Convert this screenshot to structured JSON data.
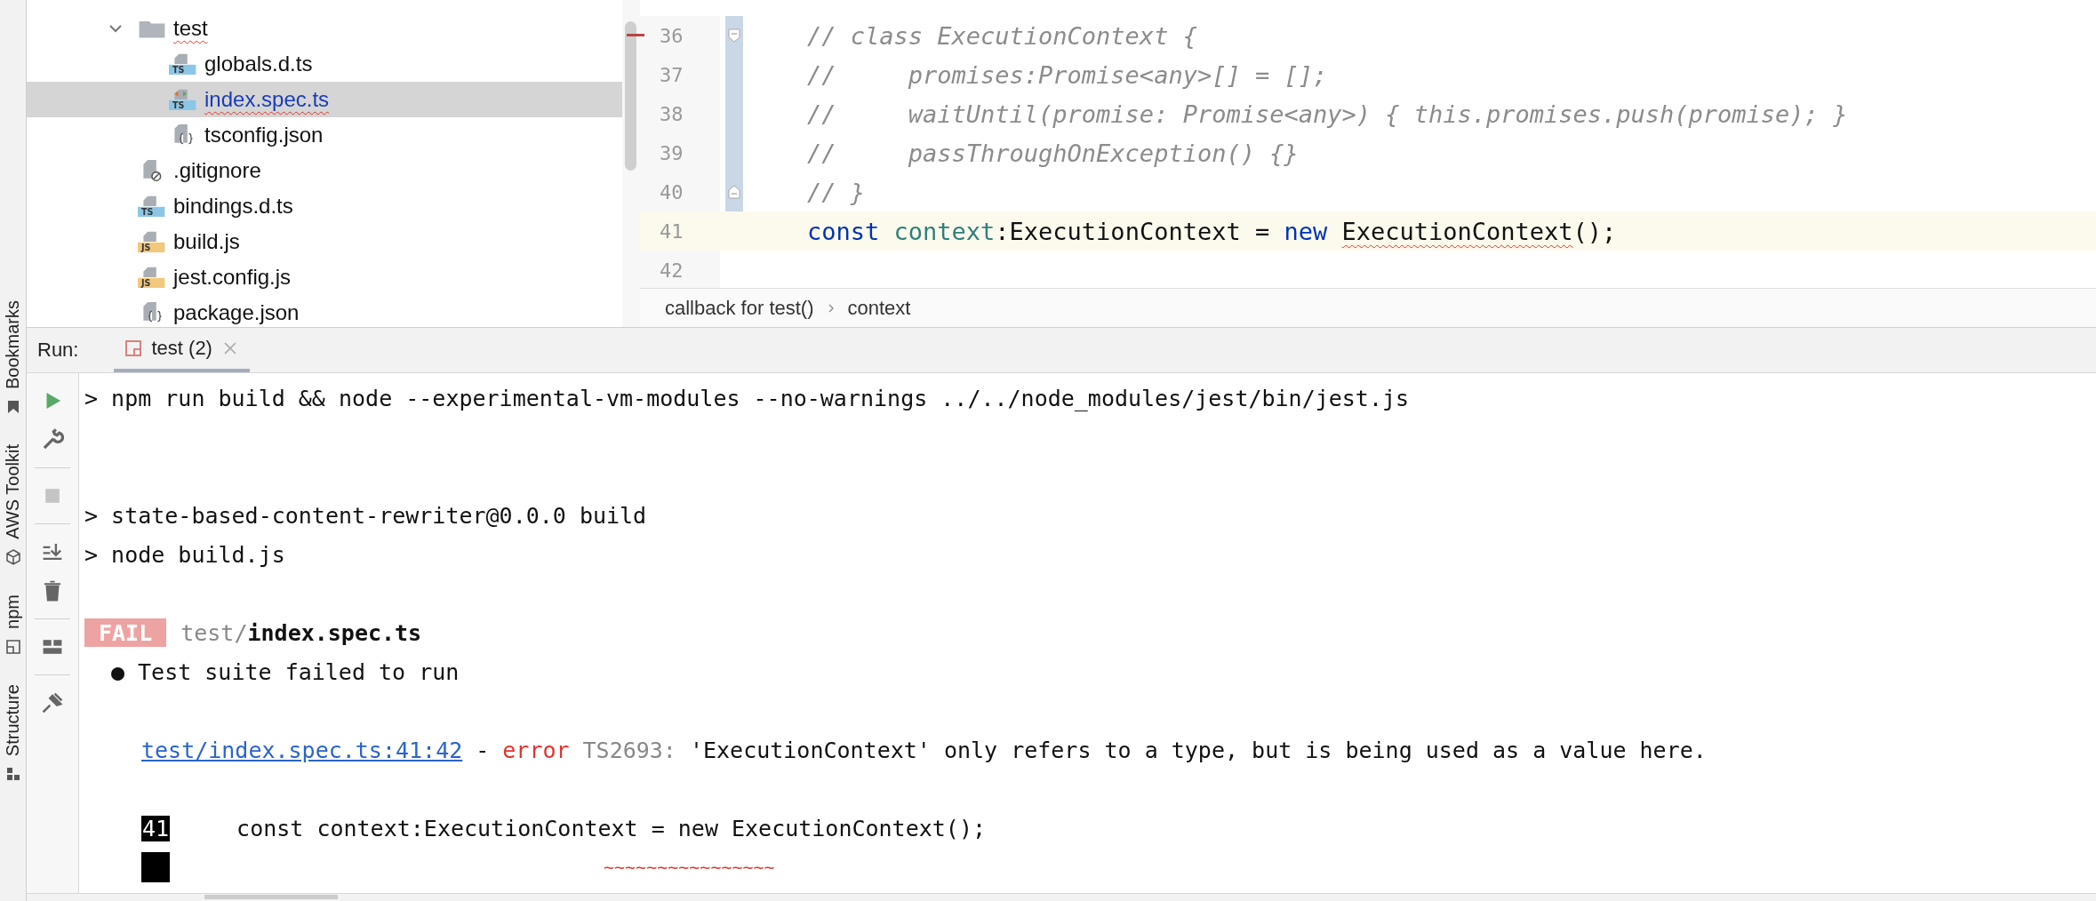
{
  "side_strip": {
    "items": [
      {
        "label": "Bookmarks",
        "kind": "bookmark"
      },
      {
        "label": "AWS Toolkit",
        "kind": "cube"
      },
      {
        "label": "npm",
        "kind": "npm"
      },
      {
        "label": "Structure",
        "kind": "structure"
      }
    ]
  },
  "project_tree": {
    "items": [
      {
        "name": "test",
        "kind": "folder",
        "expanded": true,
        "selected": false,
        "error": true,
        "children": [
          {
            "name": "globals.d.ts",
            "kind": "ts",
            "icon_label": "TS",
            "selected": false,
            "error": false
          },
          {
            "name": "index.spec.ts",
            "kind": "ts-test",
            "icon_label": "TS",
            "selected": true,
            "error": true
          },
          {
            "name": "tsconfig.json",
            "kind": "json",
            "selected": false,
            "error": false
          }
        ]
      },
      {
        "name": ".gitignore",
        "kind": "ignore",
        "selected": false,
        "error": false
      },
      {
        "name": "bindings.d.ts",
        "kind": "ts",
        "icon_label": "TS",
        "selected": false,
        "error": false
      },
      {
        "name": "build.js",
        "kind": "js",
        "icon_label": "JS",
        "selected": false,
        "error": false
      },
      {
        "name": "jest.config.js",
        "kind": "js",
        "icon_label": "JS",
        "selected": false,
        "error": false
      },
      {
        "name": "package.json",
        "kind": "json",
        "selected": false,
        "error": false
      }
    ]
  },
  "editor": {
    "lines": [
      {
        "number": "36",
        "kind": "fold-start",
        "current": false,
        "tokens": [
          {
            "text": "// class ExecutionContext {",
            "kind": "comment"
          }
        ]
      },
      {
        "number": "37",
        "kind": "fold-body",
        "current": false,
        "tokens": [
          {
            "text": "//     promises:Promise<any>[] = [];",
            "kind": "comment"
          }
        ]
      },
      {
        "number": "38",
        "kind": "fold-body",
        "current": false,
        "tokens": [
          {
            "text": "//     waitUntil(promise: Promise<any>) { this.promises.push(promise); }",
            "kind": "comment"
          }
        ]
      },
      {
        "number": "39",
        "kind": "fold-body",
        "current": false,
        "tokens": [
          {
            "text": "//     passThroughOnException() {}",
            "kind": "comment"
          }
        ]
      },
      {
        "number": "40",
        "kind": "fold-end",
        "current": false,
        "tokens": [
          {
            "text": "// }",
            "kind": "comment"
          }
        ]
      },
      {
        "number": "41",
        "kind": "plain",
        "current": true,
        "tokens": [
          {
            "text": "const",
            "kind": "keyword"
          },
          {
            "text": " context",
            "kind": "field"
          },
          {
            "text": ":ExecutionContext = ",
            "kind": "plain"
          },
          {
            "text": "new ",
            "kind": "keyword"
          },
          {
            "text": "ExecutionContext",
            "kind": "error"
          },
          {
            "text": "();",
            "kind": "plain"
          }
        ]
      },
      {
        "number": "42",
        "kind": "plain",
        "current": false
      }
    ],
    "breadcrumbs": [
      "callback for test()",
      "context"
    ]
  },
  "run_panel": {
    "label": "Run:",
    "tabs": [
      {
        "label": "test (2)",
        "selected": true
      }
    ],
    "console": [
      {
        "kind": "command",
        "text": "> npm run build && node --experimental-vm-modules --no-warnings ../../node_modules/jest/bin/jest.js"
      },
      {
        "kind": "blank"
      },
      {
        "kind": "blank"
      },
      {
        "kind": "command",
        "text": "> state-based-content-rewriter@0.0.0 build"
      },
      {
        "kind": "command",
        "text": "> node build.js"
      },
      {
        "kind": "blank"
      },
      {
        "kind": "fail",
        "badge": "FAIL",
        "path_dir": "test/",
        "path_file": "index.spec.ts"
      },
      {
        "kind": "bullet",
        "bullet": "●",
        "text": "Test suite failed to run"
      },
      {
        "kind": "blank"
      },
      {
        "kind": "error",
        "link": "test/index.spec.ts:41:42",
        "separator": "-",
        "severity": "error",
        "code": "TS2693:",
        "message": "'ExecutionContext' only refers to a type, but is being used as a value here."
      },
      {
        "kind": "blank"
      },
      {
        "kind": "code",
        "line_number": "41",
        "text": "const context:ExecutionContext = new ExecutionContext();"
      },
      {
        "kind": "marker",
        "squiggle": "~~~~~~~~~~~~~~~~"
      }
    ]
  }
}
